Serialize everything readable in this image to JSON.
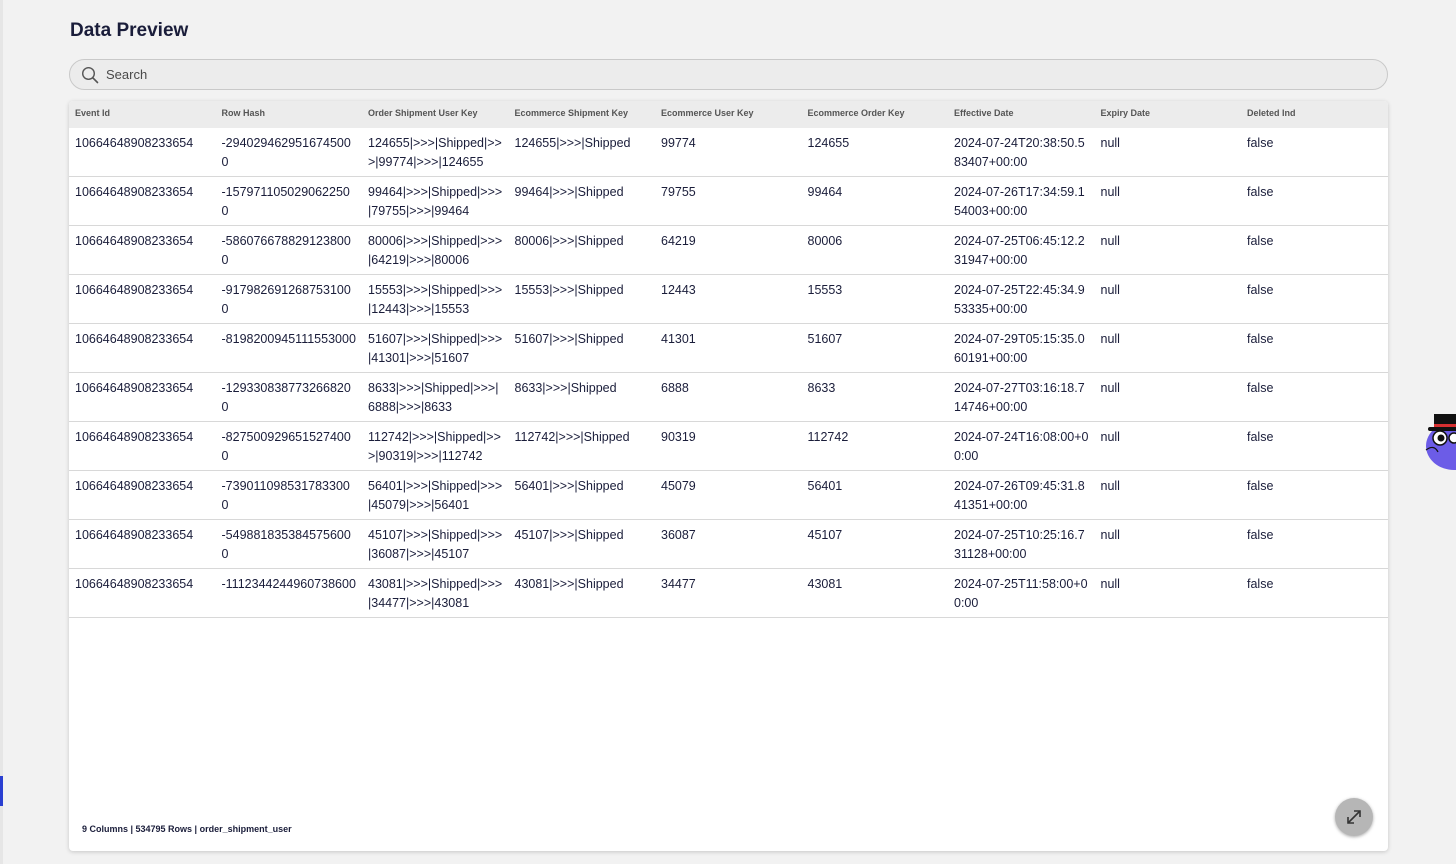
{
  "page": {
    "title": "Data Preview"
  },
  "search": {
    "placeholder": "Search"
  },
  "table": {
    "columns": [
      "Event Id",
      "Row Hash",
      "Order Shipment User Key",
      "Ecommerce Shipment Key",
      "Ecommerce User Key",
      "Ecommerce Order Key",
      "Effective Date",
      "Expiry Date",
      "Deleted Ind"
    ],
    "rows": [
      [
        "10664648908233654",
        "-2940294629516745000",
        "124655|>>>|Shipped|>>>|99774|>>>|124655",
        "124655|>>>|Shipped",
        "99774",
        "124655",
        "2024-07-24T20:38:50.583407+00:00",
        "null",
        "false"
      ],
      [
        "10664648908233654",
        "-1579711050290622500",
        "99464|>>>|Shipped|>>>|79755|>>>|99464",
        "99464|>>>|Shipped",
        "79755",
        "99464",
        "2024-07-26T17:34:59.154003+00:00",
        "null",
        "false"
      ],
      [
        "10664648908233654",
        "-5860766788291238000",
        "80006|>>>|Shipped|>>>|64219|>>>|80006",
        "80006|>>>|Shipped",
        "64219",
        "80006",
        "2024-07-25T06:45:12.231947+00:00",
        "null",
        "false"
      ],
      [
        "10664648908233654",
        "-9179826912687531000",
        "15553|>>>|Shipped|>>>|12443|>>>|15553",
        "15553|>>>|Shipped",
        "12443",
        "15553",
        "2024-07-25T22:45:34.953335+00:00",
        "null",
        "false"
      ],
      [
        "10664648908233654",
        "-8198200945111553000",
        "51607|>>>|Shipped|>>>|41301|>>>|51607",
        "51607|>>>|Shipped",
        "41301",
        "51607",
        "2024-07-29T05:15:35.060191+00:00",
        "null",
        "false"
      ],
      [
        "10664648908233654",
        "-1293308387732668200",
        "8633|>>>|Shipped|>>>|6888|>>>|8633",
        "8633|>>>|Shipped",
        "6888",
        "8633",
        "2024-07-27T03:16:18.714746+00:00",
        "null",
        "false"
      ],
      [
        "10664648908233654",
        "-8275009296515274000",
        "112742|>>>|Shipped|>>>|90319|>>>|112742",
        "112742|>>>|Shipped",
        "90319",
        "112742",
        "2024-07-24T16:08:00+00:00",
        "null",
        "false"
      ],
      [
        "10664648908233654",
        "-7390110985317833000",
        "56401|>>>|Shipped|>>>|45079|>>>|56401",
        "56401|>>>|Shipped",
        "45079",
        "56401",
        "2024-07-26T09:45:31.841351+00:00",
        "null",
        "false"
      ],
      [
        "10664648908233654",
        "-5498818353845756000",
        "45107|>>>|Shipped|>>>|36087|>>>|45107",
        "45107|>>>|Shipped",
        "36087",
        "45107",
        "2024-07-25T10:25:16.731128+00:00",
        "null",
        "false"
      ],
      [
        "10664648908233654",
        "-1112344244960738600",
        "43081|>>>|Shipped|>>>|34477|>>>|43081",
        "43081|>>>|Shipped",
        "34477",
        "43081",
        "2024-07-25T11:58:00+00:00",
        "null",
        "false"
      ]
    ]
  },
  "footer": {
    "info": "9 Columns | 534795 Rows | order_shipment_user"
  },
  "icons": {
    "search": "search-icon",
    "expand": "expand-icon",
    "mascot": "mascot-icon"
  },
  "colors": {
    "text": "#1a1d3a",
    "background": "#f2f2f2",
    "header_bg": "#ececec",
    "mascot": "#6c5ce7"
  }
}
